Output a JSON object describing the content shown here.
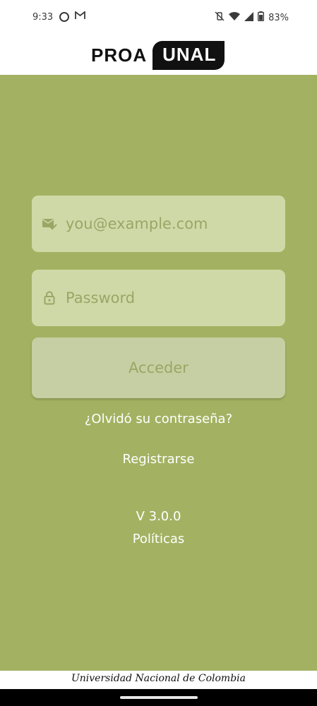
{
  "status_bar": {
    "time": "9:33",
    "left_icons": [
      "circle-icon",
      "gmail-icon"
    ],
    "right_icons": [
      "vibrate-off-icon",
      "wifi-icon",
      "signal-icon",
      "battery-icon"
    ],
    "battery": "83%"
  },
  "header": {
    "logo_left": "PROA",
    "logo_right": "UNAL"
  },
  "form": {
    "email_placeholder": "you@example.com",
    "password_placeholder": "Password",
    "submit_label": "Acceder",
    "forgot_password": "¿Olvidó su contraseña?",
    "register": "Registrarse"
  },
  "meta": {
    "version": "V 3.0.0",
    "policies": "Políticas"
  },
  "footer": {
    "university": "Universidad Nacional de Colombia"
  },
  "colors": {
    "background": "#a2b262",
    "field_bg": "#cfd9a8",
    "button_bg": "#c6cfa3",
    "placeholder": "#98a765"
  }
}
